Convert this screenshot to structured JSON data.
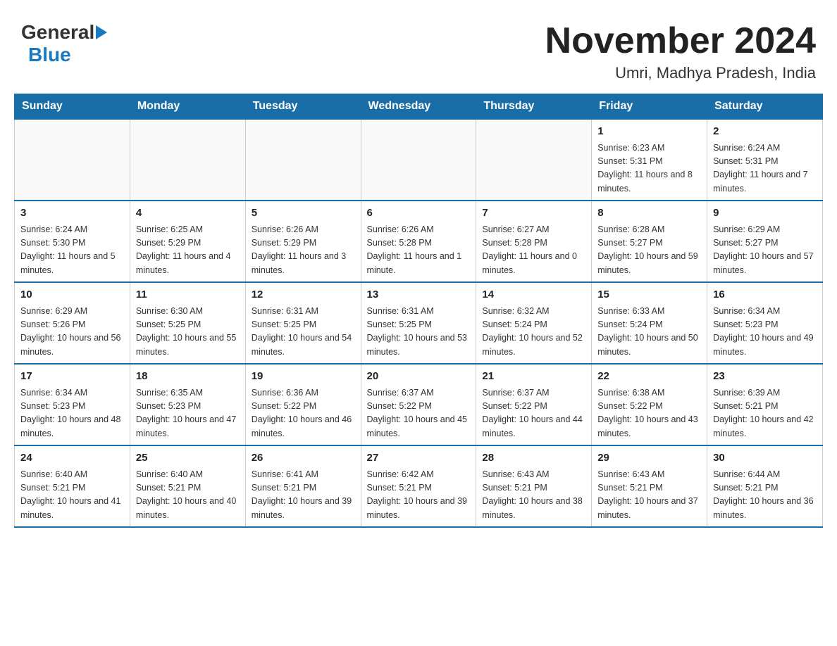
{
  "header": {
    "logo_general": "General",
    "logo_blue": "Blue",
    "main_title": "November 2024",
    "subtitle": "Umri, Madhya Pradesh, India"
  },
  "calendar": {
    "days_of_week": [
      "Sunday",
      "Monday",
      "Tuesday",
      "Wednesday",
      "Thursday",
      "Friday",
      "Saturday"
    ],
    "weeks": [
      [
        {
          "day": "",
          "info": ""
        },
        {
          "day": "",
          "info": ""
        },
        {
          "day": "",
          "info": ""
        },
        {
          "day": "",
          "info": ""
        },
        {
          "day": "",
          "info": ""
        },
        {
          "day": "1",
          "info": "Sunrise: 6:23 AM\nSunset: 5:31 PM\nDaylight: 11 hours and 8 minutes."
        },
        {
          "day": "2",
          "info": "Sunrise: 6:24 AM\nSunset: 5:31 PM\nDaylight: 11 hours and 7 minutes."
        }
      ],
      [
        {
          "day": "3",
          "info": "Sunrise: 6:24 AM\nSunset: 5:30 PM\nDaylight: 11 hours and 5 minutes."
        },
        {
          "day": "4",
          "info": "Sunrise: 6:25 AM\nSunset: 5:29 PM\nDaylight: 11 hours and 4 minutes."
        },
        {
          "day": "5",
          "info": "Sunrise: 6:26 AM\nSunset: 5:29 PM\nDaylight: 11 hours and 3 minutes."
        },
        {
          "day": "6",
          "info": "Sunrise: 6:26 AM\nSunset: 5:28 PM\nDaylight: 11 hours and 1 minute."
        },
        {
          "day": "7",
          "info": "Sunrise: 6:27 AM\nSunset: 5:28 PM\nDaylight: 11 hours and 0 minutes."
        },
        {
          "day": "8",
          "info": "Sunrise: 6:28 AM\nSunset: 5:27 PM\nDaylight: 10 hours and 59 minutes."
        },
        {
          "day": "9",
          "info": "Sunrise: 6:29 AM\nSunset: 5:27 PM\nDaylight: 10 hours and 57 minutes."
        }
      ],
      [
        {
          "day": "10",
          "info": "Sunrise: 6:29 AM\nSunset: 5:26 PM\nDaylight: 10 hours and 56 minutes."
        },
        {
          "day": "11",
          "info": "Sunrise: 6:30 AM\nSunset: 5:25 PM\nDaylight: 10 hours and 55 minutes."
        },
        {
          "day": "12",
          "info": "Sunrise: 6:31 AM\nSunset: 5:25 PM\nDaylight: 10 hours and 54 minutes."
        },
        {
          "day": "13",
          "info": "Sunrise: 6:31 AM\nSunset: 5:25 PM\nDaylight: 10 hours and 53 minutes."
        },
        {
          "day": "14",
          "info": "Sunrise: 6:32 AM\nSunset: 5:24 PM\nDaylight: 10 hours and 52 minutes."
        },
        {
          "day": "15",
          "info": "Sunrise: 6:33 AM\nSunset: 5:24 PM\nDaylight: 10 hours and 50 minutes."
        },
        {
          "day": "16",
          "info": "Sunrise: 6:34 AM\nSunset: 5:23 PM\nDaylight: 10 hours and 49 minutes."
        }
      ],
      [
        {
          "day": "17",
          "info": "Sunrise: 6:34 AM\nSunset: 5:23 PM\nDaylight: 10 hours and 48 minutes."
        },
        {
          "day": "18",
          "info": "Sunrise: 6:35 AM\nSunset: 5:23 PM\nDaylight: 10 hours and 47 minutes."
        },
        {
          "day": "19",
          "info": "Sunrise: 6:36 AM\nSunset: 5:22 PM\nDaylight: 10 hours and 46 minutes."
        },
        {
          "day": "20",
          "info": "Sunrise: 6:37 AM\nSunset: 5:22 PM\nDaylight: 10 hours and 45 minutes."
        },
        {
          "day": "21",
          "info": "Sunrise: 6:37 AM\nSunset: 5:22 PM\nDaylight: 10 hours and 44 minutes."
        },
        {
          "day": "22",
          "info": "Sunrise: 6:38 AM\nSunset: 5:22 PM\nDaylight: 10 hours and 43 minutes."
        },
        {
          "day": "23",
          "info": "Sunrise: 6:39 AM\nSunset: 5:21 PM\nDaylight: 10 hours and 42 minutes."
        }
      ],
      [
        {
          "day": "24",
          "info": "Sunrise: 6:40 AM\nSunset: 5:21 PM\nDaylight: 10 hours and 41 minutes."
        },
        {
          "day": "25",
          "info": "Sunrise: 6:40 AM\nSunset: 5:21 PM\nDaylight: 10 hours and 40 minutes."
        },
        {
          "day": "26",
          "info": "Sunrise: 6:41 AM\nSunset: 5:21 PM\nDaylight: 10 hours and 39 minutes."
        },
        {
          "day": "27",
          "info": "Sunrise: 6:42 AM\nSunset: 5:21 PM\nDaylight: 10 hours and 39 minutes."
        },
        {
          "day": "28",
          "info": "Sunrise: 6:43 AM\nSunset: 5:21 PM\nDaylight: 10 hours and 38 minutes."
        },
        {
          "day": "29",
          "info": "Sunrise: 6:43 AM\nSunset: 5:21 PM\nDaylight: 10 hours and 37 minutes."
        },
        {
          "day": "30",
          "info": "Sunrise: 6:44 AM\nSunset: 5:21 PM\nDaylight: 10 hours and 36 minutes."
        }
      ]
    ]
  }
}
